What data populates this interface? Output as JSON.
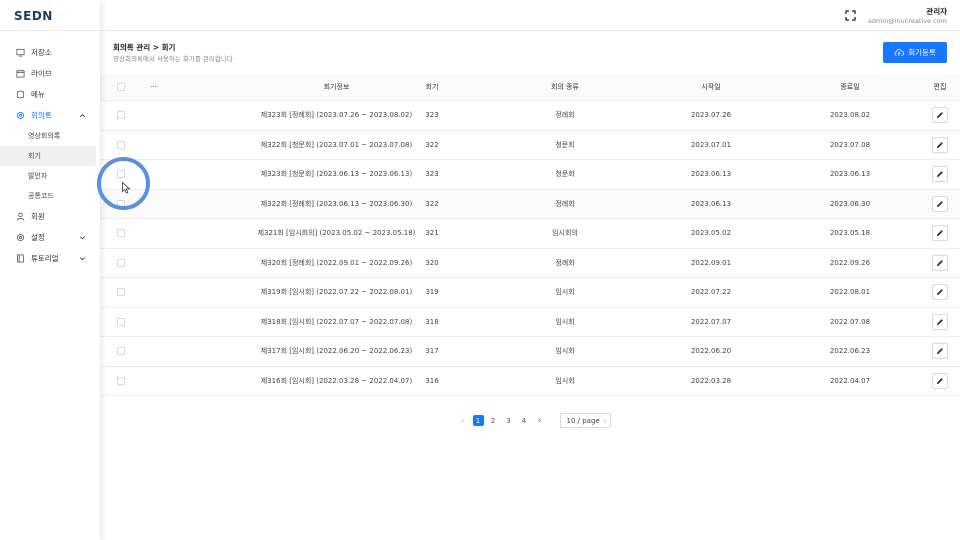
{
  "brand": {
    "logo": "SEDN"
  },
  "sidebar": {
    "items": [
      {
        "label": "저장소",
        "icon": "storage-icon"
      },
      {
        "label": "라이브",
        "icon": "live-icon"
      },
      {
        "label": "메뉴",
        "icon": "menu-icon"
      },
      {
        "label": "회의록",
        "icon": "gear-icon",
        "expanded": true
      },
      {
        "label": "회원",
        "icon": "user-icon"
      },
      {
        "label": "설정",
        "icon": "gear-icon"
      },
      {
        "label": "튜토리얼",
        "icon": "book-icon"
      }
    ],
    "subitems": [
      {
        "label": "영상회의록"
      },
      {
        "label": "회기",
        "selected": true
      },
      {
        "label": "발언자"
      },
      {
        "label": "공통코드"
      }
    ]
  },
  "header": {
    "user_name": "관리자",
    "user_email": "admin@inucreative.com"
  },
  "page": {
    "breadcrumb": "회의록 관리 > 회기",
    "subtitle": "영상회의록에서 사용하는 회기를 관리합니다",
    "add_button": "회기등록"
  },
  "table": {
    "columns": {
      "more": "···",
      "info": "회기정보",
      "round": "회기",
      "type": "회의 종류",
      "start": "시작일",
      "end": "종료일",
      "edit": "편집"
    },
    "rows": [
      {
        "info": "제323회 [정례회] (2023.07.26 ~ 2023.08.02)",
        "round": "323",
        "type": "정례회",
        "start": "2023.07.26",
        "end": "2023.08.02"
      },
      {
        "info": "제322회 [청문회] (2023.07.01 ~ 2023.07.08)",
        "round": "322",
        "type": "청문회",
        "start": "2023.07.01",
        "end": "2023.07.08"
      },
      {
        "info": "제323회 [청문회] (2023.06.13 ~ 2023.06.13)",
        "round": "323",
        "type": "청문회",
        "start": "2023.06.13",
        "end": "2023.06.13"
      },
      {
        "info": "제322회 [정례회] (2023.06.13 ~ 2023.06.30)",
        "round": "322",
        "type": "정례회",
        "start": "2023.06.13",
        "end": "2023.06.30"
      },
      {
        "info": "제321회 [임시회의] (2023.05.02 ~ 2023.05.18)",
        "round": "321",
        "type": "임시회의",
        "start": "2023.05.02",
        "end": "2023.05.18"
      },
      {
        "info": "제320회 [정례회] (2022.09.01 ~ 2022.09.26)",
        "round": "320",
        "type": "정례회",
        "start": "2022.09.01",
        "end": "2022.09.26"
      },
      {
        "info": "제319회 [임시회] (2022.07.22 ~ 2022.08.01)",
        "round": "319",
        "type": "임시회",
        "start": "2022.07.22",
        "end": "2022.08.01"
      },
      {
        "info": "제318회 [임시회] (2022.07.07 ~ 2022.07.08)",
        "round": "318",
        "type": "임시회",
        "start": "2022.07.07",
        "end": "2022.07.08"
      },
      {
        "info": "제317회 [임시회] (2022.06.20 ~ 2022.06.23)",
        "round": "317",
        "type": "임시회",
        "start": "2022.06.20",
        "end": "2022.06.23"
      },
      {
        "info": "제316회 [임시회] (2022.03.28 ~ 2022.04.07)",
        "round": "316",
        "type": "임시회",
        "start": "2022.03.28",
        "end": "2022.04.07"
      }
    ]
  },
  "pagination": {
    "prev": "‹",
    "pages": [
      "1",
      "2",
      "3",
      "4"
    ],
    "current": "1",
    "next": "›",
    "page_size": "10 / page"
  },
  "colors": {
    "accent": "#1677ff",
    "click_ring": "#5b8fe0"
  }
}
